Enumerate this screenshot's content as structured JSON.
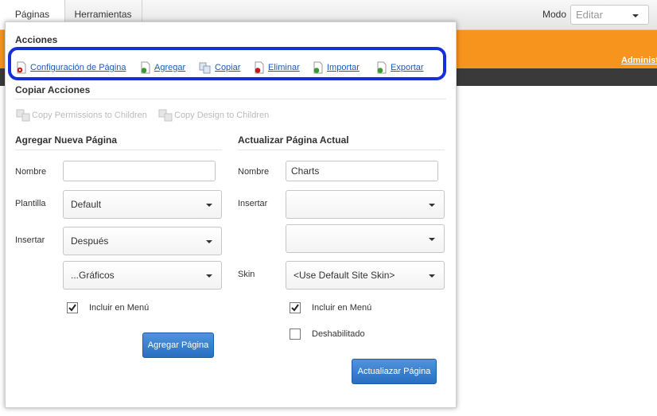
{
  "topbar": {
    "tabs": [
      {
        "label": "Páginas"
      },
      {
        "label": "Herramientas"
      }
    ],
    "mode_label": "Modo",
    "mode_value": "Editar"
  },
  "site": {
    "admin_link": "Administ"
  },
  "panel": {
    "actions_title": "Acciones",
    "actions": [
      {
        "label": "Configuración de Página",
        "icon": "page-settings-icon"
      },
      {
        "label": "Agregar",
        "icon": "page-add-icon"
      },
      {
        "label": "Copiar",
        "icon": "copy-page-icon"
      },
      {
        "label": "Eliminar",
        "icon": "page-delete-icon"
      },
      {
        "label": "Importar",
        "icon": "page-import-icon"
      },
      {
        "label": "Exportar",
        "icon": "page-export-icon"
      }
    ],
    "copy_title": "Copiar Acciones",
    "copy_actions": [
      {
        "label": "Copy Permissions to Children"
      },
      {
        "label": "Copy Design to Children"
      }
    ],
    "add_page": {
      "title": "Agregar Nueva Página",
      "name_label": "Nombre",
      "name_value": "",
      "template_label": "Plantilla",
      "template_value": "Default",
      "insert_label": "Insertar",
      "insert_position_value": "Después",
      "insert_page_value": "...Gráficos",
      "include_menu_label": "Incluir en Menú",
      "include_menu_checked": true,
      "button_label": "Agregar Página"
    },
    "update_page": {
      "title": "Actualizar Página Actual",
      "name_label": "Nombre",
      "name_value": "Charts",
      "insert_label": "Insertar",
      "insert_position_value": "",
      "insert_page_value": "",
      "skin_label": "Skin",
      "skin_value": "<Use Default Site Skin>",
      "include_menu_label": "Incluir en Menú",
      "include_menu_checked": true,
      "disabled_label": "Deshabilitado",
      "disabled_checked": false,
      "button_label": "Actualiazar Página"
    }
  },
  "colors": {
    "accent": "#f7941d",
    "highlight_ring": "#1530d9",
    "link": "#1a5bb4",
    "primary_button": "#2a6fc0"
  }
}
